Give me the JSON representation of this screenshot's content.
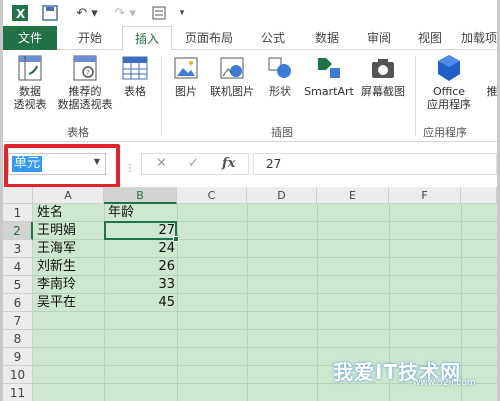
{
  "ribbon_tabs": [
    "文件",
    "开始",
    "插入",
    "页面布局",
    "公式",
    "数据",
    "审阅",
    "视图",
    "加载项"
  ],
  "active_tab": "插入",
  "ribbon": {
    "pivot_table": [
      "数据",
      "透视表"
    ],
    "recommended_pivot": [
      "推荐的",
      "数据透视表"
    ],
    "table": "表格",
    "picture": "图片",
    "online_picture": "联机图片",
    "shapes": "形状",
    "smartart": "SmartArt",
    "screenshot": "屏幕截图",
    "office_apps": [
      "Office",
      "应用程序"
    ],
    "group_tables": "表格",
    "group_illustrations": "插图",
    "group_apps": "应用程序",
    "cut_off": "推"
  },
  "name_box": {
    "value": "单元"
  },
  "formula_bar": {
    "cancel": "✕",
    "enter": "✓",
    "fx": "fx",
    "value": "27"
  },
  "columns": [
    "A",
    "B",
    "C",
    "D",
    "E",
    "F"
  ],
  "rows": [
    "1",
    "2",
    "3",
    "4",
    "5",
    "6",
    "7",
    "8",
    "9",
    "10",
    "11"
  ],
  "header": {
    "name": "姓名",
    "age": "年龄"
  },
  "records": [
    {
      "name": "王明娟",
      "age": "27"
    },
    {
      "name": "王海军",
      "age": "24"
    },
    {
      "name": "刘新生",
      "age": "26"
    },
    {
      "name": "李南玲",
      "age": "33"
    },
    {
      "name": "吴平在",
      "age": "45"
    }
  ],
  "watermark": {
    "text": "我爱IT技术网",
    "url": "www.52ij.com"
  },
  "colors": {
    "accent": "#217346",
    "highlight": "#e0242a",
    "grid_bg": "#cce8cf"
  }
}
